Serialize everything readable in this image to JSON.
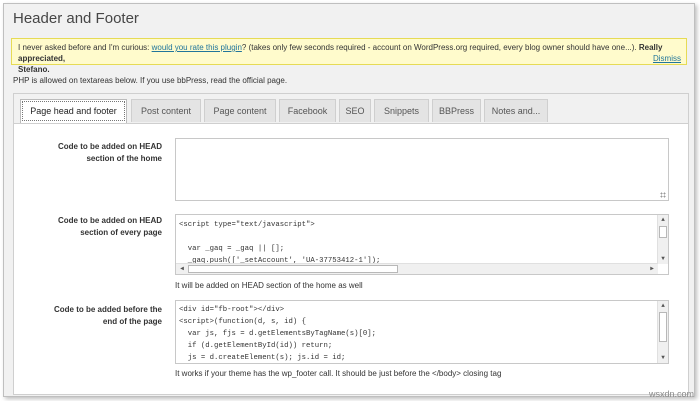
{
  "page": {
    "title": "Header and Footer"
  },
  "notice": {
    "text1": "I never asked before and I'm curious:",
    "link": "would you rate this plugin",
    "text2": "? (takes only few seconds required - account on WordPress.org required, every blog owner should have one...).",
    "thanks": "Really appreciated,",
    "signature": "Stefano.",
    "dismiss": "Dismiss"
  },
  "php_note": "PHP is allowed on textareas below. If you use bbPress, read the official page.",
  "tabs": [
    {
      "label": "Page head and footer"
    },
    {
      "label": "Post content"
    },
    {
      "label": "Page content"
    },
    {
      "label": "Facebook"
    },
    {
      "label": "SEO"
    },
    {
      "label": "Snippets"
    },
    {
      "label": "BBPress"
    },
    {
      "label": "Notes and..."
    }
  ],
  "fields": [
    {
      "label_line1": "Code to be added on HEAD",
      "label_line2": "section of the home",
      "code": [],
      "hint": ""
    },
    {
      "label_line1": "Code to be added on HEAD",
      "label_line2": "section of every page",
      "code": [
        "<script type=\"text/javascript\">",
        "",
        "  var _gaq = _gaq || [];",
        "  _gaq.push(['_setAccount', 'UA-37753412-1']);"
      ],
      "hint": "It will be added on HEAD section of the home as well"
    },
    {
      "label_line1": "Code to be added before the",
      "label_line2": "end of the page",
      "code": [
        "<div id=\"fb-root\"></div>",
        "<script>(function(d, s, id) {",
        "  var js, fjs = d.getElementsByTagName(s)[0];",
        "  if (d.getElementById(id)) return;",
        "  js = d.createElement(s); js.id = id;"
      ],
      "hint": "It works if your theme has the wp_footer call. It should be just before the </body> closing tag"
    }
  ],
  "icons": {
    "scroll_up": "triangle-up-icon",
    "scroll_down": "triangle-down-icon",
    "resize": "resize-grip-icon"
  },
  "watermark": "wsxdn.com"
}
